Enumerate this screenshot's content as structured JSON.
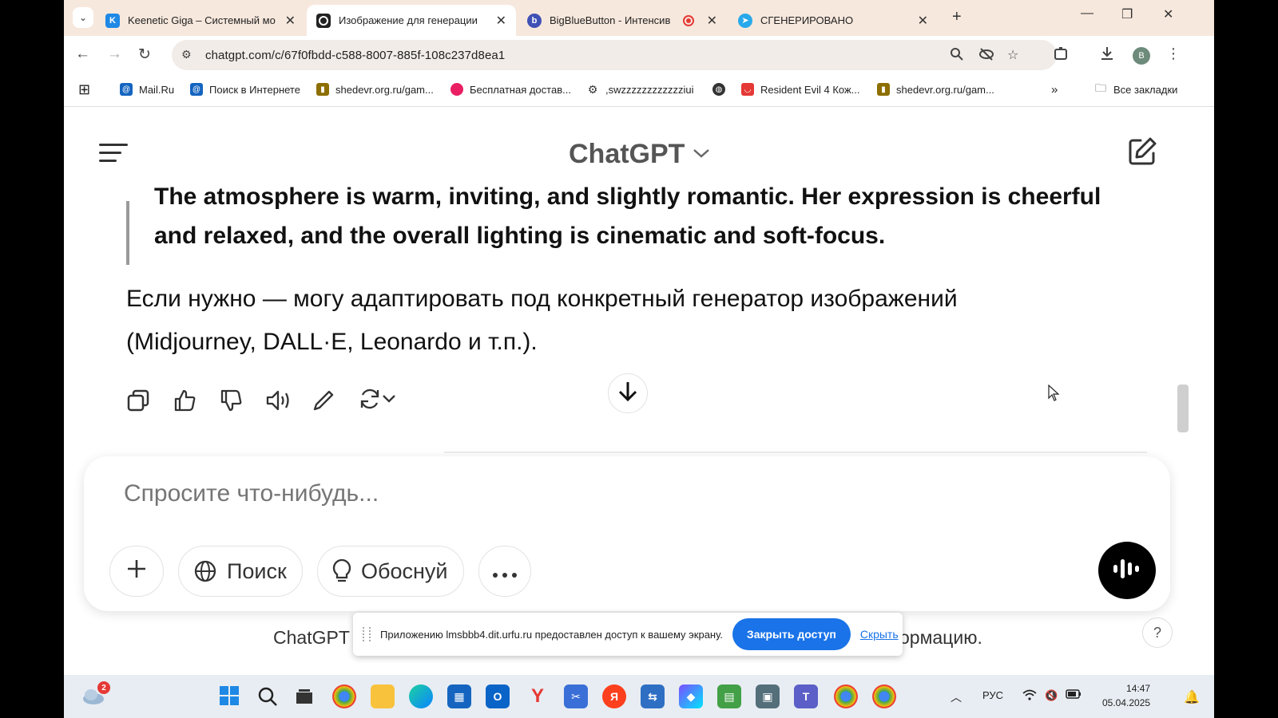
{
  "browser": {
    "tabs": [
      {
        "title": "Keenetic Giga – Системный мо",
        "favicon": "keenetic-k",
        "color": "#1e88e5",
        "active": false
      },
      {
        "title": "Изображение для генерации",
        "favicon": "openai",
        "color": "#222222",
        "active": true
      },
      {
        "title": "BigBlueButton - Интенсив",
        "favicon": "bigbluebutton",
        "color": "#3f51b5",
        "active": false,
        "recording": true
      },
      {
        "title": "СГЕНЕРИРОВАНО",
        "favicon": "telegram",
        "color": "#29a9eb",
        "active": false
      }
    ],
    "new_tab_label": "+",
    "url": "chatgpt.com/c/67f0fbdd-c588-8007-885f-108c237d8ea1",
    "profile_initial": "B",
    "bookmarks": [
      {
        "label": "Mail.Ru",
        "icon": "at-icon",
        "color": "#1565c0"
      },
      {
        "label": "Поиск в Интернете",
        "icon": "at-icon",
        "color": "#1565c0"
      },
      {
        "label": "shedevr.org.ru/gam...",
        "icon": "shedevr-icon",
        "color": "#8d6e00"
      },
      {
        "label": "Бесплатная достав...",
        "icon": "promo-icon",
        "color": "#e91e63"
      },
      {
        "label": ",swzzzzzzzzzzzziui",
        "icon": "gear-icon",
        "color": "#333333"
      },
      {
        "label": "",
        "icon": "globe-icon",
        "color": "#333333"
      },
      {
        "label": "Resident Evil 4 Кож...",
        "icon": "aliexpress-icon",
        "color": "#e53935"
      },
      {
        "label": "shedevr.org.ru/gam...",
        "icon": "shedevr-icon",
        "color": "#8d6e00"
      }
    ],
    "all_bookmarks_label": "Все закладки"
  },
  "chat": {
    "app_title": "ChatGPT",
    "quote_line1": "The atmosphere is warm, inviting, and slightly romantic. Her expression is cheerful",
    "quote_line2": "and relaxed, and the overall lighting is cinematic and soft-focus.",
    "paragraph_line1": "Если нужно — могу адаптировать под конкретный генератор изображений",
    "paragraph_line2": "(Midjourney, DALL·E, Leonardo и т.п.).",
    "input_placeholder": "Спросите что-нибудь...",
    "search_label": "Поиск",
    "reason_label": "Обоснуй",
    "footer_left": "ChatGPT м",
    "footer_right": "ормацию.",
    "help_label": "?"
  },
  "share_banner": {
    "message": "Приложению lmsbbb4.dit.urfu.ru предоставлен доступ к вашему экрану.",
    "stop_label": "Закрыть доступ",
    "hide_label": "Скрыть"
  },
  "taskbar": {
    "weather_badge": "2",
    "language": "РУС",
    "time": "14:47",
    "date": "05.04.2025"
  },
  "colors": {
    "accent_blue": "#1a73e8",
    "tab_strip": "#f7e8dd"
  }
}
